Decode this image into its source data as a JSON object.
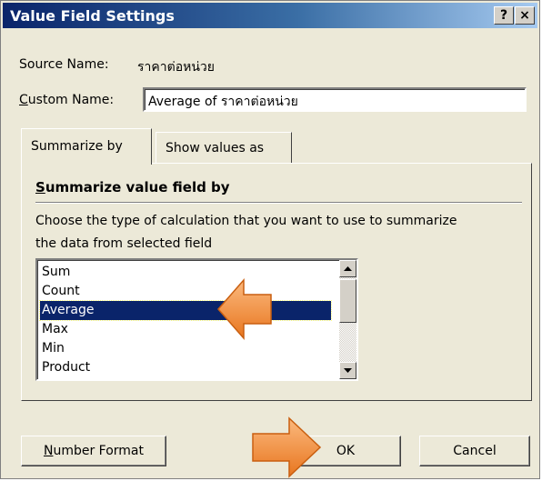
{
  "dialog": {
    "title": "Value Field Settings",
    "help_button": "?",
    "close_button": "×"
  },
  "source": {
    "label": "Source Name:",
    "value": "ราคาต่อหน่วย"
  },
  "custom_name": {
    "label_underlined": "C",
    "label_rest": "ustom Name:",
    "value": "Average of ราคาต่อหน่วย"
  },
  "tabs": [
    {
      "label": "Summarize by",
      "active": true
    },
    {
      "label": "Show values as",
      "active": false
    }
  ],
  "summarize": {
    "section_title_underlined": "S",
    "section_title_rest": "ummarize value field by",
    "description_line1": "Choose the type of calculation that you want to use to summarize",
    "description_line2": "the data from selected field",
    "options": [
      "Sum",
      "Count",
      "Average",
      "Max",
      "Min",
      "Product"
    ],
    "selected": "Average"
  },
  "buttons": {
    "number_format_underlined": "N",
    "number_format_rest": "umber Format",
    "ok": "OK",
    "cancel": "Cancel"
  },
  "annotations": {
    "arrow_color": "#f5924a"
  },
  "colors": {
    "title_start": "#0a246a",
    "title_end": "#a6caf0",
    "selection": "#0a246a",
    "dialog_bg": "#ece9d8"
  }
}
